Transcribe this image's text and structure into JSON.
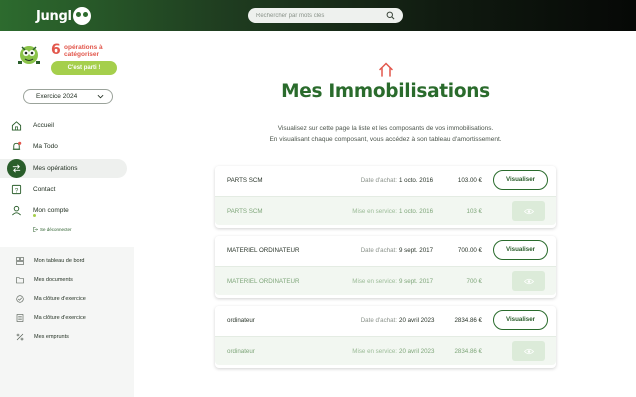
{
  "topbar": {
    "logo_text": "Jungl",
    "search_placeholder": "Rechercher par mots clés"
  },
  "promo": {
    "count": "6",
    "text": "opérations à catégoriser",
    "button": "C'est parti !"
  },
  "sidebar": {
    "year_select": "Exercice 2024",
    "items": [
      {
        "label": "Accueil",
        "icon": "home-icon"
      },
      {
        "label": "Ma Todo",
        "icon": "bell-icon"
      },
      {
        "label": "Mes opérations",
        "icon": "transfer-icon",
        "active": true
      },
      {
        "label": "Contact",
        "icon": "help-icon"
      },
      {
        "label": "Mon compte",
        "icon": "user-icon"
      }
    ],
    "logout": "Se déconnecter",
    "sub_items": [
      {
        "label": "Mon tableau de bord",
        "icon": "dashboard-icon"
      },
      {
        "label": "Mes documents",
        "icon": "folder-icon"
      },
      {
        "label": "Ma clôture d'exercice",
        "icon": "check-circle-icon"
      },
      {
        "label": "Ma clôture d'exercice",
        "icon": "document-icon"
      },
      {
        "label": "Mes emprunts",
        "icon": "percent-icon"
      }
    ]
  },
  "main": {
    "title": "Mes Immobilisations",
    "description_line1": "Visualisez sur cette page la liste et les composants de vos immobilisations.",
    "description_line2": "En visualisant chaque composant, vous accédez à son tableau d'amortissement.",
    "assets": [
      {
        "name": "PARTS SCM",
        "purchase_label": "Date d'achat:",
        "purchase_date": "1 octo. 2016",
        "purchase_amount": "103.00 €",
        "view_label": "Visualiser",
        "component_name": "PARTS SCM",
        "service_label": "Mise en service:",
        "service_date": "1 octo. 2016",
        "component_amount": "103 €"
      },
      {
        "name": "MATERIEL ORDINATEUR",
        "purchase_label": "Date d'achat:",
        "purchase_date": "9 sept. 2017",
        "purchase_amount": "700.00 €",
        "view_label": "Visualiser",
        "component_name": "MATERIEL ORDINATEUR",
        "service_label": "Mise en service:",
        "service_date": "9 sept. 2017",
        "component_amount": "700 €"
      },
      {
        "name": "ordinateur",
        "purchase_label": "Date d'achat:",
        "purchase_date": "20 avril 2023",
        "purchase_amount": "2834.86 €",
        "view_label": "Visualiser",
        "component_name": "ordinateur",
        "service_label": "Mise en service:",
        "service_date": "20 avril 2023",
        "component_amount": "2834.86 €"
      }
    ]
  },
  "colors": {
    "brand_green": "#2a6b2c",
    "accent_lime": "#a5cf4c",
    "alert_red": "#e2574c"
  }
}
